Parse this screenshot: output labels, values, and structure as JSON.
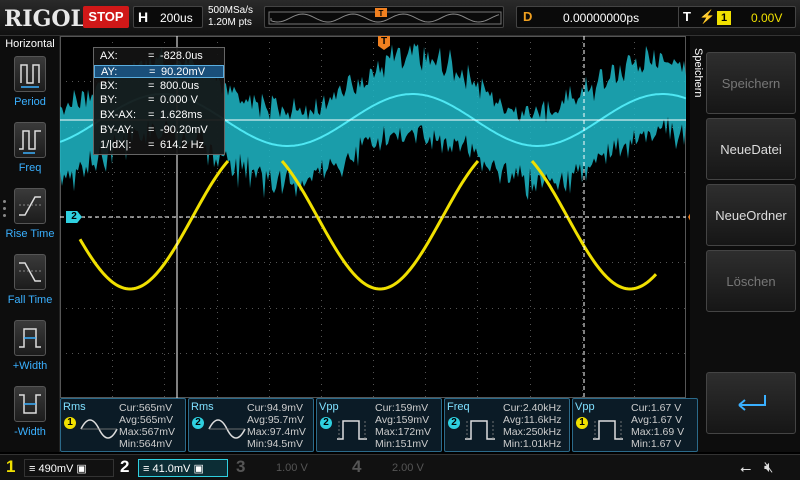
{
  "header": {
    "logo": "RIGOL",
    "run_state": "STOP",
    "timebase_key": "H",
    "timebase_value": "200us",
    "sample_rate": "500MSa/s",
    "memory_depth": "1.20M pts",
    "trigger_marker": "T",
    "delay_key": "D",
    "delay_value": "0.00000000ps",
    "trigger_key": "T",
    "trigger_source": "1",
    "trigger_level": "0.00V"
  },
  "left_menu": {
    "title": "Horizontal",
    "items": [
      {
        "label": "Period",
        "icon": "period-icon"
      },
      {
        "label": "Freq",
        "icon": "frequency-icon"
      },
      {
        "label": "Rise Time",
        "icon": "rise-time-icon"
      },
      {
        "label": "Fall Time",
        "icon": "fall-time-icon"
      },
      {
        "label": "+Width",
        "icon": "positive-width-icon"
      },
      {
        "label": "-Width",
        "icon": "negative-width-icon"
      }
    ]
  },
  "right_menu": {
    "title": "Speichern",
    "buttons": [
      {
        "label": "Speichern",
        "enabled": false
      },
      {
        "label": "NeueDatei",
        "enabled": true
      },
      {
        "label": "NeueOrdner",
        "enabled": true
      },
      {
        "label": "Löschen",
        "enabled": false
      },
      {
        "label": "enter-arrow-icon",
        "enabled": true
      }
    ]
  },
  "cursors": [
    {
      "key": "AX:",
      "value": "-828.0us"
    },
    {
      "key": "AY:",
      "value": "90.20mV"
    },
    {
      "key": "BX:",
      "value": "800.0us"
    },
    {
      "key": "BY:",
      "value": "0.000 V"
    },
    {
      "key": "BX-AX:",
      "value": "1.628ms"
    },
    {
      "key": "BY-AY:",
      "value": "-90.20mV"
    },
    {
      "key": "1/|dX|:",
      "value": "614.2 Hz"
    }
  ],
  "cursor_selected_row": 1,
  "channel_markers": {
    "ch2_left": "2",
    "trigger_top": "T",
    "trigger_right": "T"
  },
  "measurements": [
    {
      "name": "Rms",
      "channel": "1",
      "cur": "Cur:565mV",
      "avg": "Avg:565mV",
      "max": "Max:567mV",
      "min": "Min:564mV",
      "icon": "sine-wave-icon"
    },
    {
      "name": "Rms",
      "channel": "2",
      "cur": "Cur:94.9mV",
      "avg": "Avg:95.7mV",
      "max": "Max:97.4mV",
      "min": "Min:94.5mV",
      "icon": "sine-wave-icon"
    },
    {
      "name": "Vpp",
      "channel": "2",
      "cur": "Cur:159mV",
      "avg": "Avg:159mV",
      "max": "Max:172mV",
      "min": "Min:151mV",
      "icon": "pulse-icon"
    },
    {
      "name": "Freq",
      "channel": "2",
      "cur": "Cur:2.40kHz",
      "avg": "Avg:11.6kHz",
      "max": "Max:250kHz",
      "min": "Min:1.01kHz",
      "icon": "pulse-icon"
    },
    {
      "name": "Vpp",
      "channel": "1",
      "cur": "Cur:1.67 V",
      "avg": "Avg:1.67 V",
      "max": "Max:1.69 V",
      "min": "Min:1.67 V",
      "icon": "pulse-icon"
    }
  ],
  "channels": [
    {
      "num": "1",
      "value": "490mV",
      "color": "#f0e000",
      "active": true
    },
    {
      "num": "2",
      "value": "41.0mV",
      "color": "#2fd0e0",
      "active": true
    },
    {
      "num": "3",
      "value": "1.00 V",
      "color": "#555555",
      "active": false
    },
    {
      "num": "4",
      "value": "2.00 V",
      "color": "#555555",
      "active": false
    }
  ],
  "status_icons": [
    "usb-icon",
    "speaker-muted-icon"
  ],
  "colors": {
    "ch1": "#f0e000",
    "ch2": "#2fd0e0",
    "stop": "#d01818",
    "accent": "#3ab0ff",
    "trigger": "#f08020"
  }
}
